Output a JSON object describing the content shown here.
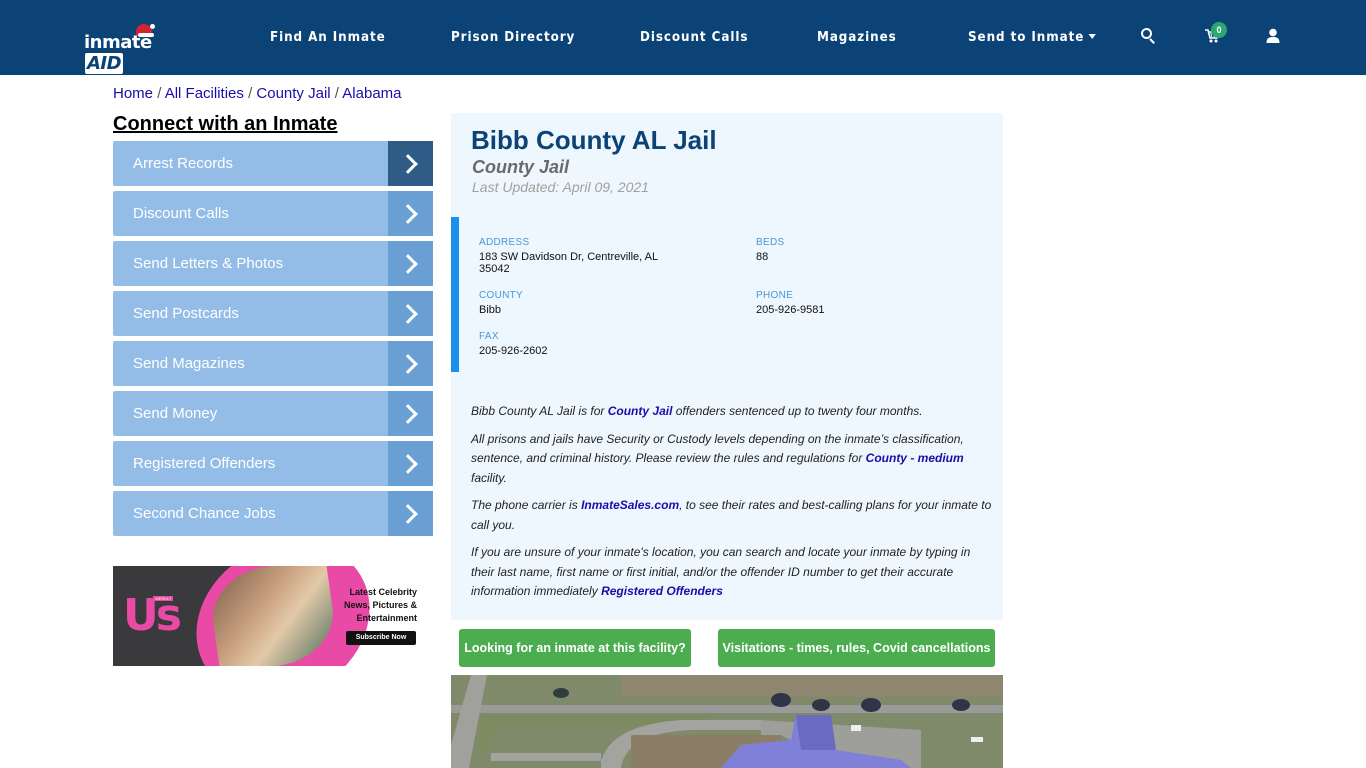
{
  "header": {
    "logo_text": "inmate",
    "logo_accent": "AID",
    "nav": [
      {
        "label": "Find An Inmate"
      },
      {
        "label": "Prison Directory"
      },
      {
        "label": "Discount Calls"
      },
      {
        "label": "Magazines"
      },
      {
        "label": "Send to Inmate",
        "has_dropdown": true
      }
    ],
    "icons": {
      "search": "search-icon",
      "cart": "cart-icon",
      "user": "user-icon"
    },
    "cart_count": "0"
  },
  "breadcrumb": [
    {
      "label": "Home"
    },
    {
      "label": "All Facilities"
    },
    {
      "label": "County Jail"
    },
    {
      "label": "Alabama"
    }
  ],
  "sidebar": {
    "title": "Connect with an Inmate",
    "items": [
      {
        "label": "Arrest Records",
        "active": true
      },
      {
        "label": "Discount Calls"
      },
      {
        "label": "Send Letters & Photos"
      },
      {
        "label": "Send Postcards"
      },
      {
        "label": "Send Magazines"
      },
      {
        "label": "Send Money"
      },
      {
        "label": "Registered Offenders"
      },
      {
        "label": "Second Chance Jobs"
      }
    ],
    "ad": {
      "brand": "Us",
      "brand_tag": "WEEKLY",
      "headline": "Latest Celebrity News, Pictures & Entertainment",
      "cta": "Subscribe Now"
    }
  },
  "facility": {
    "name": "Bibb County AL Jail",
    "type": "County Jail",
    "last_updated": "Last Updated: April 09, 2021",
    "fields": {
      "address": {
        "label": "ADDRESS",
        "value": "183 SW Davidson Dr, Centreville, AL 35042"
      },
      "beds": {
        "label": "BEDS",
        "value": "88"
      },
      "county": {
        "label": "COUNTY",
        "value": "Bibb"
      },
      "phone": {
        "label": "PHONE",
        "value": "205-926-9581"
      },
      "fax": {
        "label": "FAX",
        "value": "205-926-2602"
      }
    },
    "description": {
      "p1_a": "Bibb County AL Jail is for ",
      "p1_link": "County Jail",
      "p1_b": " offenders sentenced up to twenty four months.",
      "p2_a": "All prisons and jails have Security or Custody levels depending on the inmate’s classification, sentence, and criminal history. Please review the rules and regulations for ",
      "p2_link": "County - medium",
      "p2_b": " facility.",
      "p3_a": "The phone carrier is ",
      "p3_link": "InmateSales.com",
      "p3_b": ", to see their rates and best-calling plans for your inmate to call you.",
      "p4_a": "If you are unsure of your inmate's location, you can search and locate your inmate by typing in their last name, first name or first initial, and/or the offender ID number to get their accurate information immediately ",
      "p4_link": "Registered Offenders"
    },
    "buttons": {
      "find_inmate": "Looking for an inmate at this facility?",
      "visitations": "Visitations - times, rules, Covid cancellations"
    }
  },
  "colors": {
    "nav_bg": "#0b4377",
    "side_item": "#93bde6",
    "side_arrow": "#6a9fd3",
    "side_arrow_active": "#2f5b87",
    "panel_bg": "#edf7fd",
    "accent_bar": "#1a8ff0",
    "green_button": "#4cad50",
    "link": "#1a0dab"
  }
}
